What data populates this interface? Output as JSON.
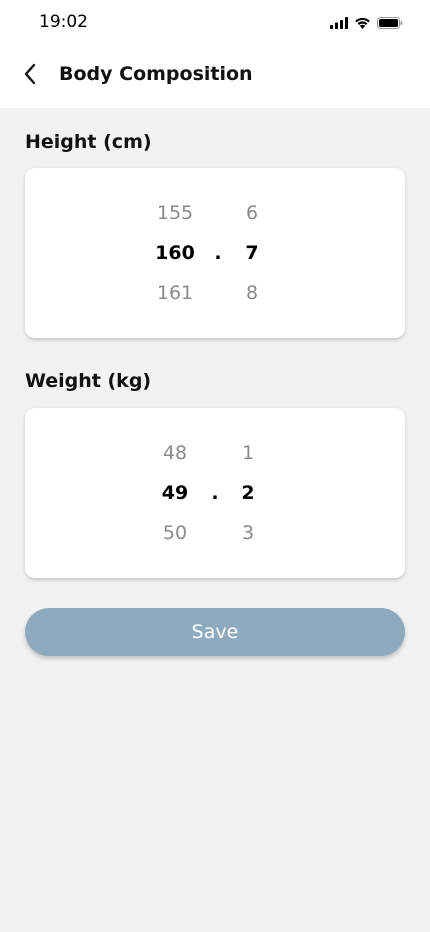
{
  "status_bar": {
    "time": "19:02",
    "icons": [
      "cellular-signal-icon",
      "wifi-icon",
      "battery-icon"
    ]
  },
  "header": {
    "back_icon": "chevron-left-icon",
    "title": "Body Composition"
  },
  "height": {
    "label": "Height (cm)",
    "integer": {
      "above": "155",
      "selected": "160",
      "below": "161"
    },
    "separator": ".",
    "decimal": {
      "above": "6",
      "selected": "7",
      "below": "8"
    }
  },
  "weight": {
    "label": "Weight (kg)",
    "integer": {
      "above": "48",
      "selected": "49",
      "below": "50"
    },
    "separator": ".",
    "decimal": {
      "above": "1",
      "selected": "2",
      "below": "3"
    }
  },
  "save_button": {
    "label": "Save"
  },
  "colors": {
    "background": "#f2f2f2",
    "card": "#ffffff",
    "save_button": "#8eaabf",
    "dim_text": "#8a8a8a"
  }
}
